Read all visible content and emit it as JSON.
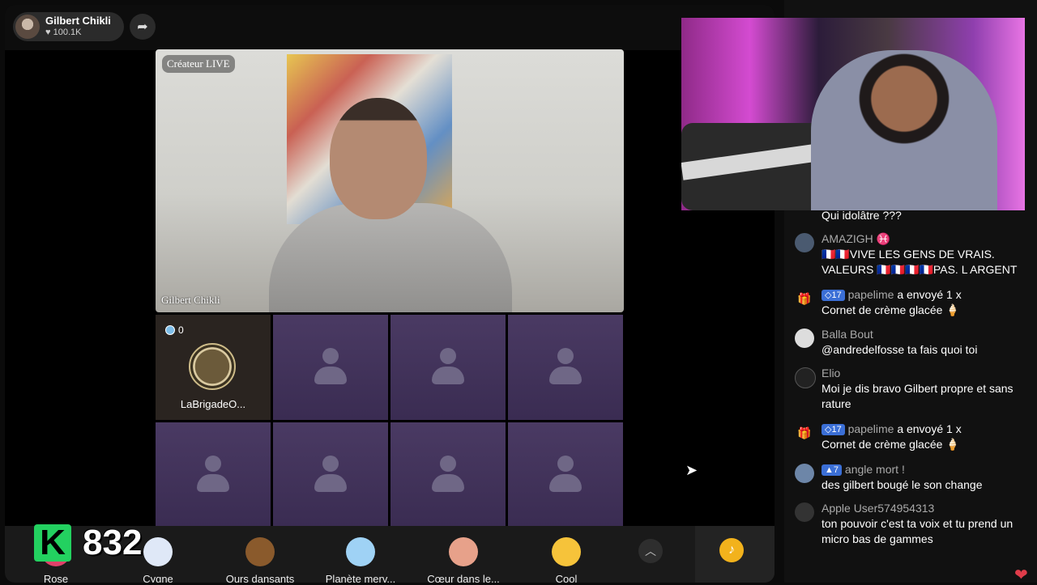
{
  "host": {
    "name": "Gilbert Chikli",
    "likes": "100.1K"
  },
  "video": {
    "creator_badge": "Créateur LIVE",
    "name": "Gilbert Chikli"
  },
  "guest": {
    "count": "0",
    "name": "LaBrigadeO..."
  },
  "gifts": [
    {
      "label": "Rose",
      "icon": "rose-icon",
      "color": "#e0416a"
    },
    {
      "label": "Cygne",
      "icon": "swan-icon",
      "color": "#dfe8f7"
    },
    {
      "label": "Ours dansants",
      "icon": "dancing-bears-icon",
      "color": "#8a5a2c"
    },
    {
      "label": "Planète merv...",
      "icon": "planet-icon",
      "color": "#9fd2f5"
    },
    {
      "label": "Cœur dans le...",
      "icon": "heart-hands-icon",
      "color": "#e7a18a"
    },
    {
      "label": "Cool",
      "icon": "sunglasses-emoji-icon",
      "color": "#f6c33a"
    }
  ],
  "score": {
    "k": "K",
    "value": "832"
  },
  "chat": [
    {
      "user": "",
      "message": "Qui idolâtre ???"
    },
    {
      "user": "AMAZIGH ♓",
      "message": "🇫🇷🇫🇷VIVE LES GENS DE VRAIS. VALEURS 🇫🇷🇫🇷🇫🇷🇫🇷PAS. L ARGENT"
    },
    {
      "badge": "◇17",
      "user": "papelime",
      "action": "a envoyé 1 x",
      "message": "Cornet de crème glacée 🍦"
    },
    {
      "user": "Balla Bout",
      "message": "@andredelfosse ta fais quoi toi"
    },
    {
      "user": "Elio",
      "message": "Moi je dis bravo Gilbert propre et sans rature"
    },
    {
      "badge": "◇17",
      "user": "papelime",
      "action": "a envoyé 1 x",
      "message": "Cornet de crème glacée 🍦"
    },
    {
      "badge": "▲7",
      "user": "angle mort !",
      "message": "des gilbert bougé le son change"
    },
    {
      "user": "Apple User574954313",
      "message": "ton pouvoir c'est ta voix et tu prend un micro bas de gammes"
    }
  ]
}
